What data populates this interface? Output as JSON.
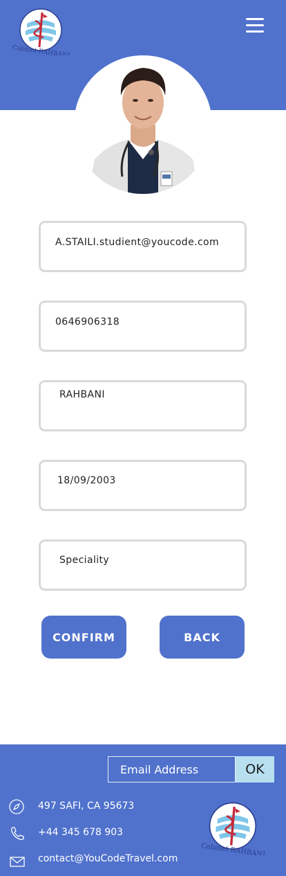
{
  "header": {
    "logo_text": "Cabinet RAHBANI",
    "menu_icon": "hamburger-menu-icon"
  },
  "profile": {
    "avatar_alt": "doctor-profile-photo"
  },
  "form": {
    "email": "A.STAILI.studient@youcode.com",
    "phone": "0646906318",
    "last_name": "RAHBANI",
    "birth_date": "18/09/2003",
    "speciality_placeholder": "Speciality"
  },
  "actions": {
    "confirm_label": "CONFIRM",
    "back_label": "BACK"
  },
  "footer": {
    "newsletter_placeholder": "Email Address",
    "ok_label": "OK",
    "address": "497  SAFI, CA 95673",
    "phone": "+44 345 678 903",
    "email": "contact@YouCodeTravel.com",
    "logo_text": "Cabinet RAHBANI"
  },
  "colors": {
    "primary": "#5072cc",
    "field_border": "#d9d9d9",
    "ok_button": "#b7dff0",
    "white": "#ffffff"
  }
}
